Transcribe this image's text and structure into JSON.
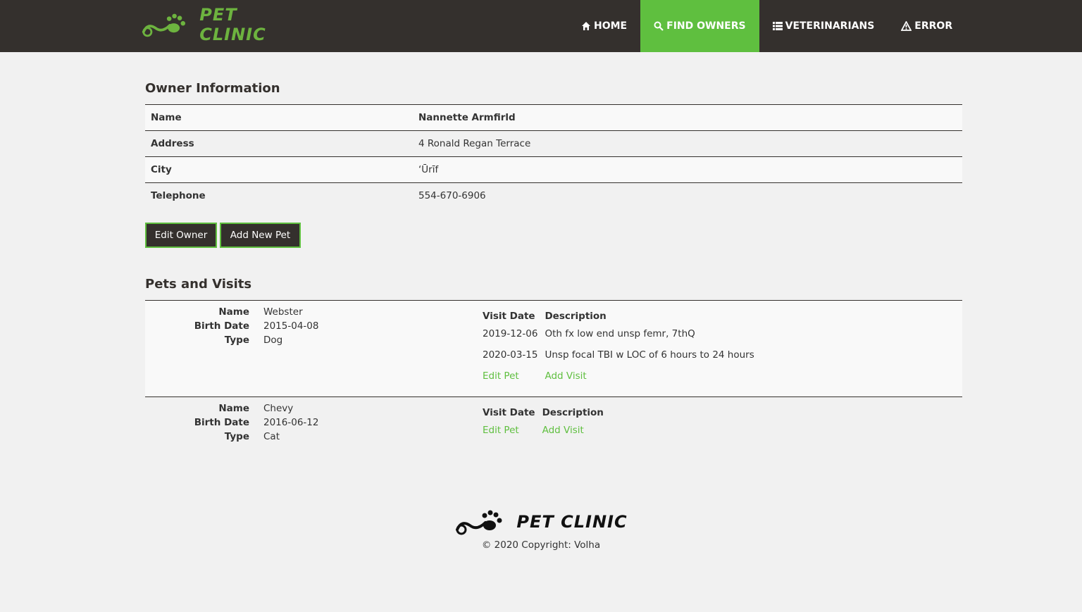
{
  "brand": {
    "name": "PET CLINIC"
  },
  "nav": [
    {
      "label": "HOME",
      "icon": "home-icon",
      "active": false
    },
    {
      "label": "FIND OWNERS",
      "icon": "search-icon",
      "active": true
    },
    {
      "label": "VETERINARIANS",
      "icon": "list-icon",
      "active": false
    },
    {
      "label": "ERROR",
      "icon": "warning-icon",
      "active": false
    }
  ],
  "owner": {
    "heading": "Owner Information",
    "rows": [
      {
        "label": "Name",
        "value": "Nannette Armfirld"
      },
      {
        "label": "Address",
        "value": "4 Ronald Regan Terrace"
      },
      {
        "label": "City",
        "value": "‘Ūrīf"
      },
      {
        "label": "Telephone",
        "value": "554-670-6906"
      }
    ],
    "edit_button": "Edit Owner",
    "add_pet_button": "Add New Pet"
  },
  "pets": {
    "heading": "Pets and Visits",
    "labels": {
      "name": "Name",
      "birth_date": "Birth Date",
      "type": "Type",
      "visit_date": "Visit Date",
      "description": "Description",
      "edit_pet": "Edit Pet",
      "add_visit": "Add Visit"
    },
    "items": [
      {
        "name": "Webster",
        "birth_date": "2015-04-08",
        "type": "Dog",
        "visits": [
          {
            "date": "2019-12-06",
            "description": "Oth fx low end unsp femr, 7thQ"
          },
          {
            "date": "2020-03-15",
            "description": "Unsp focal TBI w LOC of 6 hours to 24 hours"
          }
        ]
      },
      {
        "name": "Chevy",
        "birth_date": "2016-06-12",
        "type": "Cat",
        "visits": []
      }
    ]
  },
  "footer": {
    "brand": "PET CLINIC",
    "copyright": "© 2020 Copyright: Volha"
  },
  "colors": {
    "nav_bg": "#34302d",
    "accent": "#5fbf3f",
    "logo_green": "#6db33f"
  }
}
